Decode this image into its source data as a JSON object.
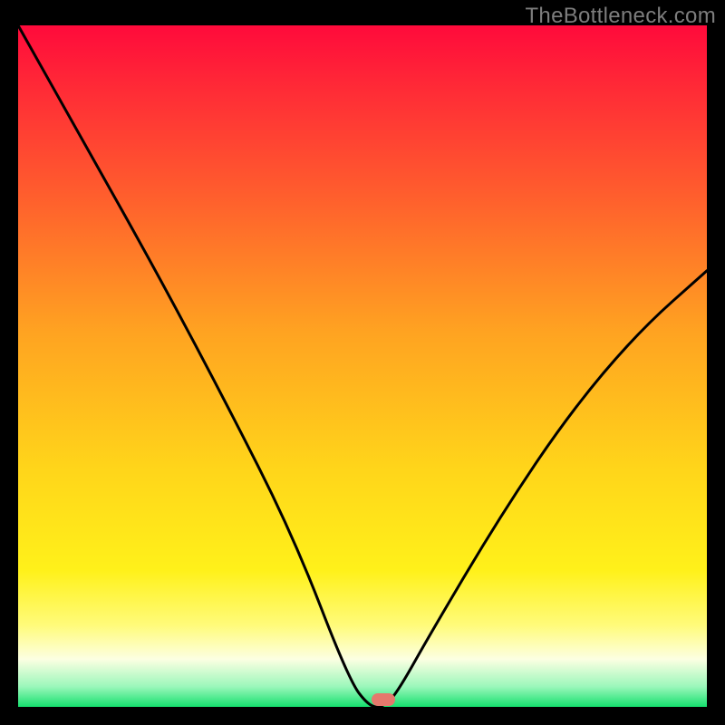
{
  "watermark": "TheBottleneck.com",
  "marker": {
    "color": "#e5786c"
  },
  "chart_data": {
    "type": "line",
    "title": "",
    "xlabel": "",
    "ylabel": "",
    "xlim": [
      0,
      100
    ],
    "ylim": [
      0,
      100
    ],
    "series": [
      {
        "name": "bottleneck-curve",
        "x": [
          0,
          10,
          20,
          30,
          40,
          48,
          51,
          53,
          55,
          60,
          70,
          80,
          90,
          100
        ],
        "y": [
          100,
          82,
          64,
          45,
          25,
          4,
          0,
          0,
          2,
          11,
          28,
          43,
          55,
          64
        ]
      }
    ],
    "flat_bottom_range_x": [
      49,
      54
    ],
    "marker_x": 53,
    "background_gradient_stops": [
      {
        "offset": 0.0,
        "color": "#ff0a3b"
      },
      {
        "offset": 0.1,
        "color": "#ff2d36"
      },
      {
        "offset": 0.25,
        "color": "#ff5e2d"
      },
      {
        "offset": 0.45,
        "color": "#ffa321"
      },
      {
        "offset": 0.65,
        "color": "#ffd51a"
      },
      {
        "offset": 0.8,
        "color": "#fff11a"
      },
      {
        "offset": 0.88,
        "color": "#fffb7a"
      },
      {
        "offset": 0.93,
        "color": "#fcffe2"
      },
      {
        "offset": 0.97,
        "color": "#9cf7bb"
      },
      {
        "offset": 1.0,
        "color": "#15e06e"
      }
    ]
  }
}
